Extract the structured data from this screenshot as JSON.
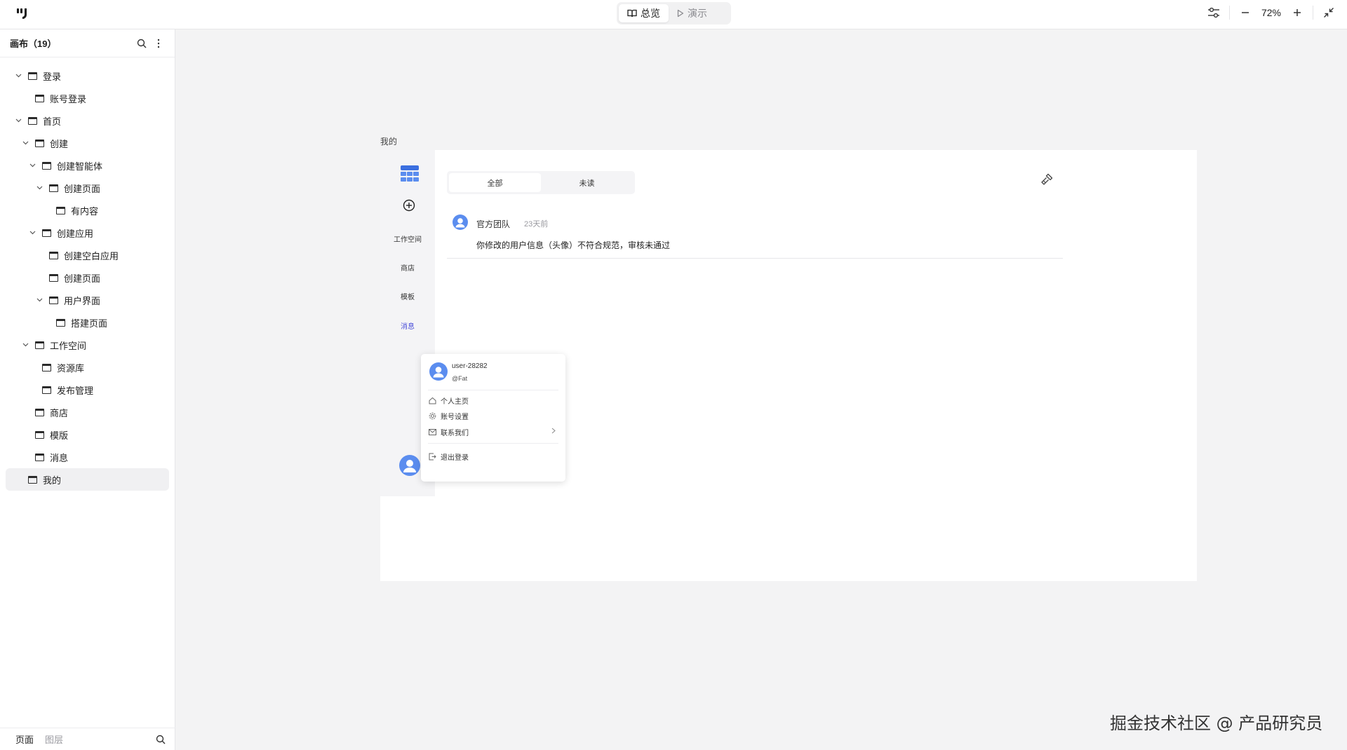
{
  "topbar": {
    "overview_label": "总览",
    "present_label": "演示",
    "zoom": "72%"
  },
  "sidebar": {
    "title": "画布（19）",
    "tree": [
      {
        "label": "登录",
        "expanded": true
      },
      {
        "label": "账号登录"
      },
      {
        "label": "首页",
        "expanded": true
      },
      {
        "label": "创建",
        "expanded": true
      },
      {
        "label": "创建智能体",
        "expanded": true
      },
      {
        "label": "创建页面",
        "expanded": true
      },
      {
        "label": "有内容"
      },
      {
        "label": "创建应用",
        "expanded": true
      },
      {
        "label": "创建空白应用"
      },
      {
        "label": "创建页面"
      },
      {
        "label": "用户界面",
        "expanded": true
      },
      {
        "label": "搭建页面"
      },
      {
        "label": "工作空间",
        "expanded": true
      },
      {
        "label": "资源库"
      },
      {
        "label": "发布管理"
      },
      {
        "label": "商店"
      },
      {
        "label": "模版"
      },
      {
        "label": "消息"
      },
      {
        "label": "我的",
        "selected": true
      }
    ],
    "footer_tabs": [
      "页面",
      "图层"
    ]
  },
  "canvas": {
    "frame_label": "我的",
    "nav": {
      "workspace": "工作空间",
      "store": "商店",
      "template": "模板",
      "messages": "消息"
    },
    "tabs": [
      "全部",
      "未读"
    ],
    "message": {
      "sender": "官方团队",
      "time": "23天前",
      "body": "你修改的用户信息（头像）不符合规范，审核未通过"
    },
    "user_menu": {
      "username": "user-28282",
      "handle": "@Fat",
      "items": [
        "个人主页",
        "账号设置",
        "联系我们",
        "退出登录"
      ]
    },
    "accent_color": "#4b4fd9",
    "avatar_color": "#5b8def"
  },
  "watermark": "掘金技术社区 @ 产品研究员"
}
